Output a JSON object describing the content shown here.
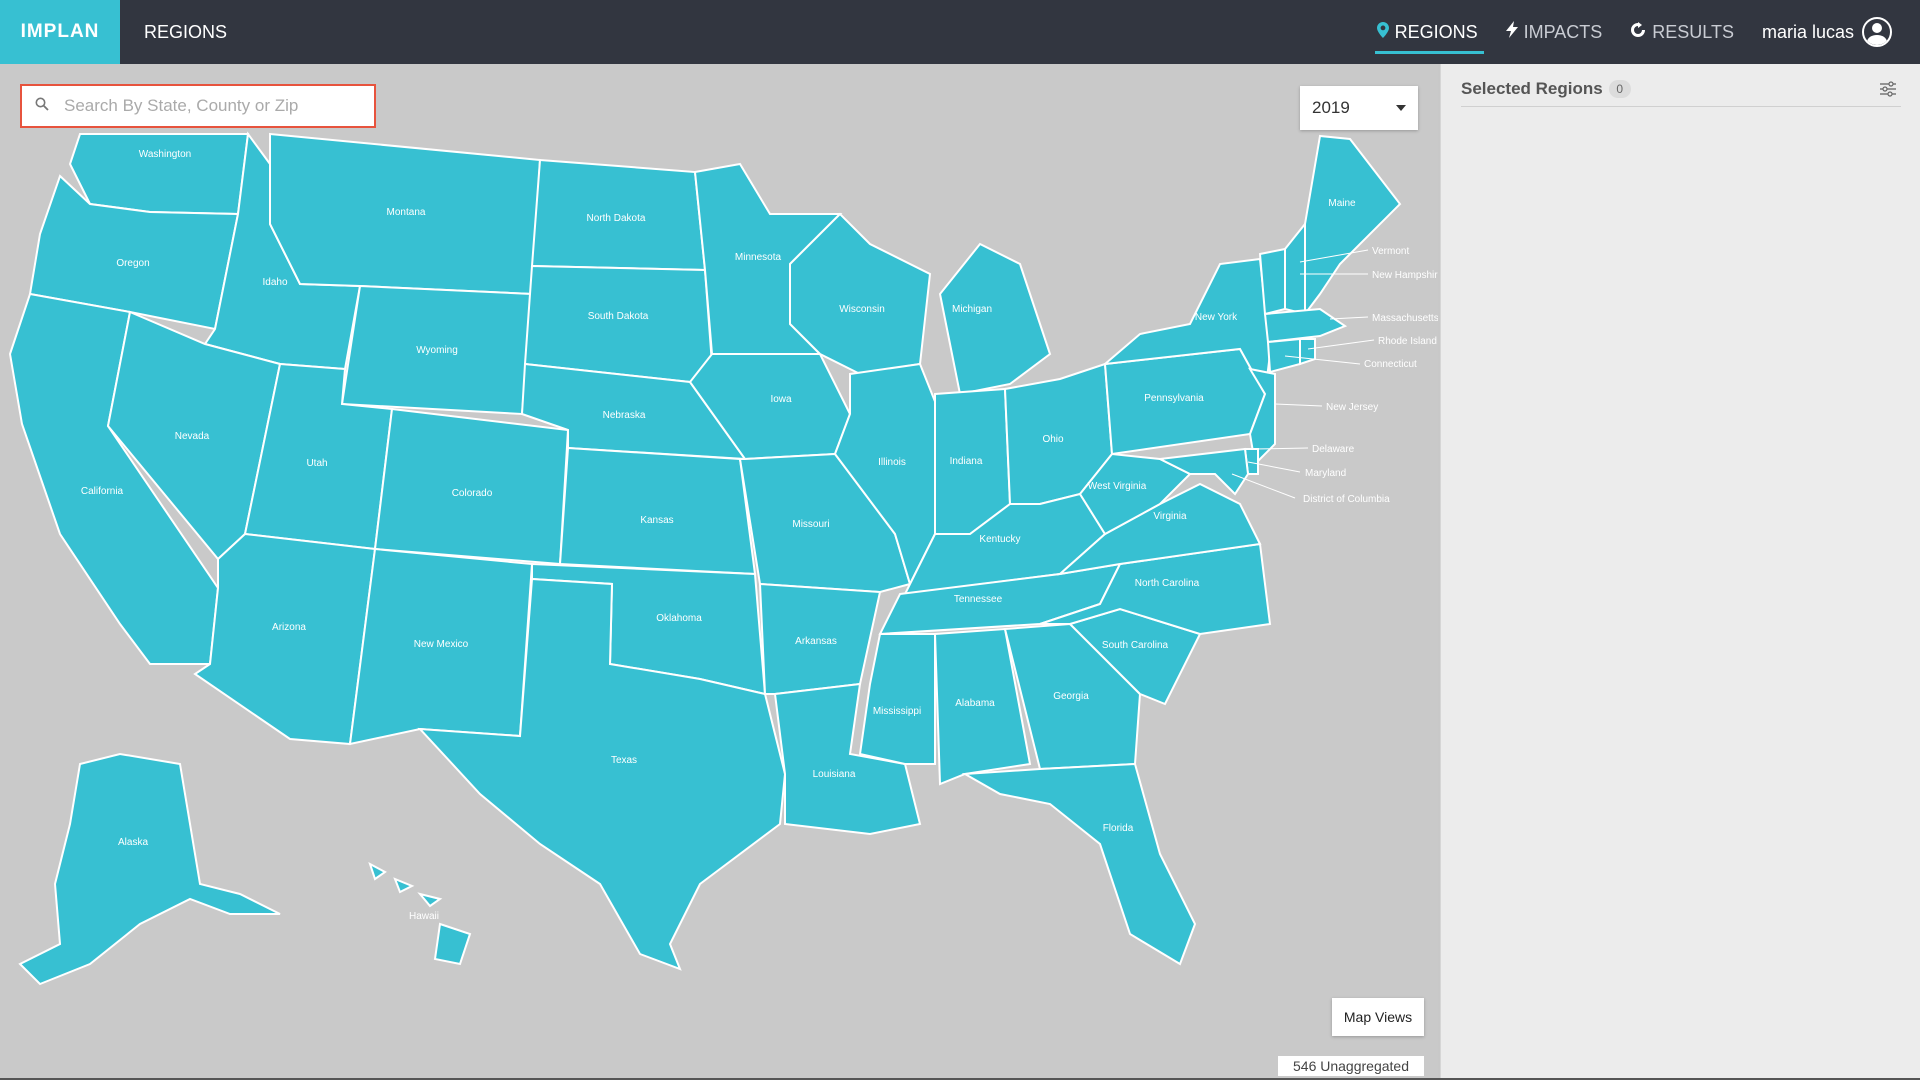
{
  "app": {
    "logo": "IMPLAN",
    "page_title": "REGIONS"
  },
  "nav": {
    "tabs": [
      {
        "label": "REGIONS",
        "icon": "map-pin-icon",
        "active": true
      },
      {
        "label": "IMPACTS",
        "icon": "lightning-icon",
        "active": false
      },
      {
        "label": "RESULTS",
        "icon": "refresh-icon",
        "active": false
      }
    ],
    "user": {
      "name": "maria lucas",
      "icon": "user-avatar-icon"
    }
  },
  "search": {
    "placeholder": "Search By State, County or Zip",
    "value": ""
  },
  "year_select": {
    "value": "2019"
  },
  "map": {
    "states": [
      "Washington",
      "Oregon",
      "California",
      "Idaho",
      "Nevada",
      "Montana",
      "Wyoming",
      "Utah",
      "Arizona",
      "Colorado",
      "New Mexico",
      "North Dakota",
      "South Dakota",
      "Nebraska",
      "Kansas",
      "Oklahoma",
      "Texas",
      "Minnesota",
      "Iowa",
      "Missouri",
      "Arkansas",
      "Louisiana",
      "Wisconsin",
      "Illinois",
      "Michigan",
      "Indiana",
      "Ohio",
      "Kentucky",
      "Tennessee",
      "Mississippi",
      "Alabama",
      "Georgia",
      "Florida",
      "South Carolina",
      "North Carolina",
      "Virginia",
      "West Virginia",
      "Pennsylvania",
      "New York",
      "Maine",
      "Vermont",
      "New Hampshire",
      "Massachusetts",
      "Rhode Island",
      "Connecticut",
      "New Jersey",
      "Delaware",
      "Maryland",
      "District of Columbia",
      "Alaska",
      "Hawaii"
    ],
    "fill_color": "#37c0d2",
    "map_views_label": "Map Views",
    "unaggregated_label": "546 Unaggregated"
  },
  "panel": {
    "title": "Selected Regions",
    "count": "0"
  },
  "colors": {
    "topbar": "#323640",
    "accent": "#37c0d2",
    "map_bg": "#c9c9c9",
    "panel_bg": "#ececec",
    "search_border": "#e7533d"
  }
}
